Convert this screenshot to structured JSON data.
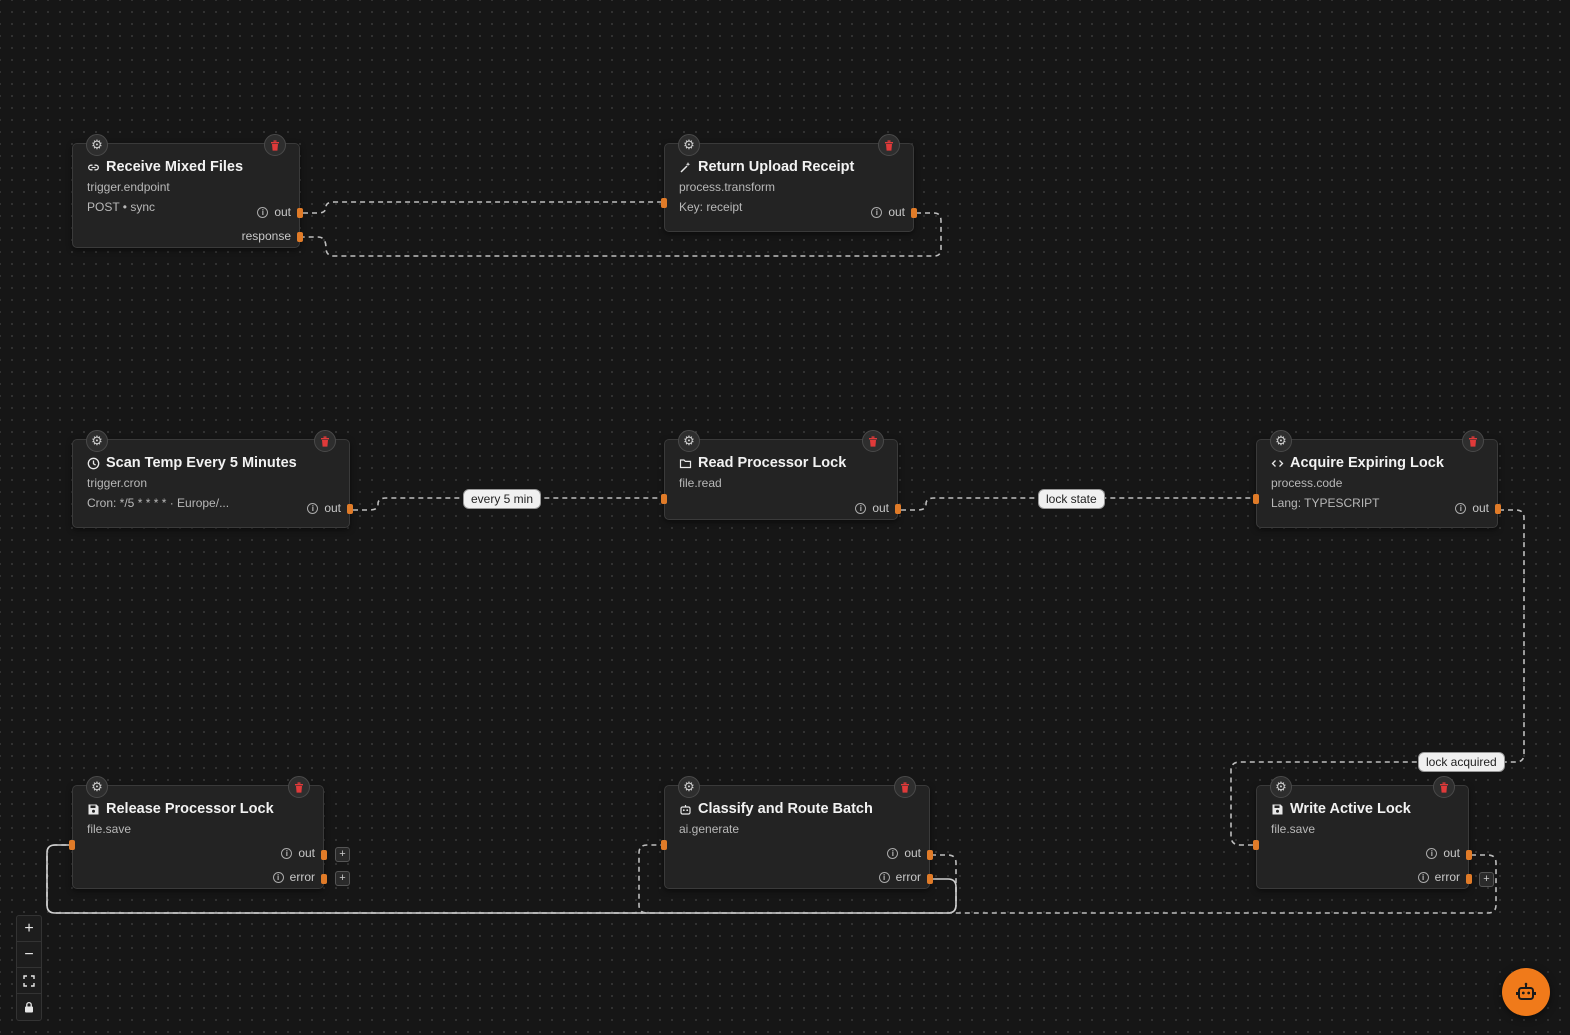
{
  "nodes": [
    {
      "id": "receive-mixed-files",
      "title": "Receive Mixed Files",
      "icon": "link-icon",
      "type": "trigger.endpoint",
      "detail": "POST • sync",
      "ports": [
        "out",
        "response"
      ]
    },
    {
      "id": "return-upload-receipt",
      "title": "Return Upload Receipt",
      "icon": "magic-wand-icon",
      "type": "process.transform",
      "detail": "Key: receipt",
      "ports": [
        "out"
      ]
    },
    {
      "id": "scan-temp",
      "title": "Scan Temp Every 5 Minutes",
      "icon": "clock-icon",
      "type": "trigger.cron",
      "detail": "Cron: */5 * * * * · Europe/...",
      "ports": [
        "out"
      ]
    },
    {
      "id": "read-processor-lock",
      "title": "Read Processor Lock",
      "icon": "folder-icon",
      "type": "file.read",
      "detail": "",
      "ports": [
        "out"
      ]
    },
    {
      "id": "acquire-expiring-lock",
      "title": "Acquire Expiring Lock",
      "icon": "code-icon",
      "type": "process.code",
      "detail": "Lang: TYPESCRIPT",
      "ports": [
        "out"
      ]
    },
    {
      "id": "release-processor-lock",
      "title": "Release Processor Lock",
      "icon": "save-icon",
      "type": "file.save",
      "detail": "",
      "ports": [
        "out",
        "error"
      ]
    },
    {
      "id": "classify-route-batch",
      "title": "Classify and Route Batch",
      "icon": "robot-icon",
      "type": "ai.generate",
      "detail": "",
      "ports": [
        "out",
        "error"
      ]
    },
    {
      "id": "write-active-lock",
      "title": "Write Active Lock",
      "icon": "save-icon",
      "type": "file.save",
      "detail": "",
      "ports": [
        "out",
        "error"
      ]
    }
  ],
  "edge_labels": {
    "every_5_min": "every 5 min",
    "lock_state": "lock state",
    "lock_acquired": "lock acquired"
  },
  "controls": {
    "zoom_in": "+",
    "zoom_out": "−",
    "plus": "+"
  },
  "colors": {
    "accent": "#e07b28",
    "background": "#161616",
    "node": "#232323",
    "delete": "#e03a3a"
  }
}
